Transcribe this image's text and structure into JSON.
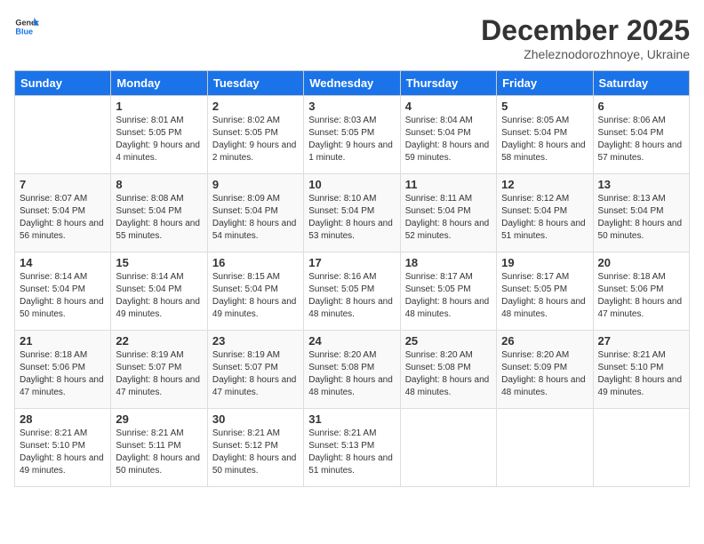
{
  "logo": {
    "line1": "General",
    "line2": "Blue"
  },
  "title": "December 2025",
  "subtitle": "Zheleznodorozhnoye, Ukraine",
  "weekdays": [
    "Sunday",
    "Monday",
    "Tuesday",
    "Wednesday",
    "Thursday",
    "Friday",
    "Saturday"
  ],
  "weeks": [
    [
      {
        "day": "",
        "sunrise": "",
        "sunset": "",
        "daylight": ""
      },
      {
        "day": "1",
        "sunrise": "Sunrise: 8:01 AM",
        "sunset": "Sunset: 5:05 PM",
        "daylight": "Daylight: 9 hours and 4 minutes."
      },
      {
        "day": "2",
        "sunrise": "Sunrise: 8:02 AM",
        "sunset": "Sunset: 5:05 PM",
        "daylight": "Daylight: 9 hours and 2 minutes."
      },
      {
        "day": "3",
        "sunrise": "Sunrise: 8:03 AM",
        "sunset": "Sunset: 5:05 PM",
        "daylight": "Daylight: 9 hours and 1 minute."
      },
      {
        "day": "4",
        "sunrise": "Sunrise: 8:04 AM",
        "sunset": "Sunset: 5:04 PM",
        "daylight": "Daylight: 8 hours and 59 minutes."
      },
      {
        "day": "5",
        "sunrise": "Sunrise: 8:05 AM",
        "sunset": "Sunset: 5:04 PM",
        "daylight": "Daylight: 8 hours and 58 minutes."
      },
      {
        "day": "6",
        "sunrise": "Sunrise: 8:06 AM",
        "sunset": "Sunset: 5:04 PM",
        "daylight": "Daylight: 8 hours and 57 minutes."
      }
    ],
    [
      {
        "day": "7",
        "sunrise": "Sunrise: 8:07 AM",
        "sunset": "Sunset: 5:04 PM",
        "daylight": "Daylight: 8 hours and 56 minutes."
      },
      {
        "day": "8",
        "sunrise": "Sunrise: 8:08 AM",
        "sunset": "Sunset: 5:04 PM",
        "daylight": "Daylight: 8 hours and 55 minutes."
      },
      {
        "day": "9",
        "sunrise": "Sunrise: 8:09 AM",
        "sunset": "Sunset: 5:04 PM",
        "daylight": "Daylight: 8 hours and 54 minutes."
      },
      {
        "day": "10",
        "sunrise": "Sunrise: 8:10 AM",
        "sunset": "Sunset: 5:04 PM",
        "daylight": "Daylight: 8 hours and 53 minutes."
      },
      {
        "day": "11",
        "sunrise": "Sunrise: 8:11 AM",
        "sunset": "Sunset: 5:04 PM",
        "daylight": "Daylight: 8 hours and 52 minutes."
      },
      {
        "day": "12",
        "sunrise": "Sunrise: 8:12 AM",
        "sunset": "Sunset: 5:04 PM",
        "daylight": "Daylight: 8 hours and 51 minutes."
      },
      {
        "day": "13",
        "sunrise": "Sunrise: 8:13 AM",
        "sunset": "Sunset: 5:04 PM",
        "daylight": "Daylight: 8 hours and 50 minutes."
      }
    ],
    [
      {
        "day": "14",
        "sunrise": "Sunrise: 8:14 AM",
        "sunset": "Sunset: 5:04 PM",
        "daylight": "Daylight: 8 hours and 50 minutes."
      },
      {
        "day": "15",
        "sunrise": "Sunrise: 8:14 AM",
        "sunset": "Sunset: 5:04 PM",
        "daylight": "Daylight: 8 hours and 49 minutes."
      },
      {
        "day": "16",
        "sunrise": "Sunrise: 8:15 AM",
        "sunset": "Sunset: 5:04 PM",
        "daylight": "Daylight: 8 hours and 49 minutes."
      },
      {
        "day": "17",
        "sunrise": "Sunrise: 8:16 AM",
        "sunset": "Sunset: 5:05 PM",
        "daylight": "Daylight: 8 hours and 48 minutes."
      },
      {
        "day": "18",
        "sunrise": "Sunrise: 8:17 AM",
        "sunset": "Sunset: 5:05 PM",
        "daylight": "Daylight: 8 hours and 48 minutes."
      },
      {
        "day": "19",
        "sunrise": "Sunrise: 8:17 AM",
        "sunset": "Sunset: 5:05 PM",
        "daylight": "Daylight: 8 hours and 48 minutes."
      },
      {
        "day": "20",
        "sunrise": "Sunrise: 8:18 AM",
        "sunset": "Sunset: 5:06 PM",
        "daylight": "Daylight: 8 hours and 47 minutes."
      }
    ],
    [
      {
        "day": "21",
        "sunrise": "Sunrise: 8:18 AM",
        "sunset": "Sunset: 5:06 PM",
        "daylight": "Daylight: 8 hours and 47 minutes."
      },
      {
        "day": "22",
        "sunrise": "Sunrise: 8:19 AM",
        "sunset": "Sunset: 5:07 PM",
        "daylight": "Daylight: 8 hours and 47 minutes."
      },
      {
        "day": "23",
        "sunrise": "Sunrise: 8:19 AM",
        "sunset": "Sunset: 5:07 PM",
        "daylight": "Daylight: 8 hours and 47 minutes."
      },
      {
        "day": "24",
        "sunrise": "Sunrise: 8:20 AM",
        "sunset": "Sunset: 5:08 PM",
        "daylight": "Daylight: 8 hours and 48 minutes."
      },
      {
        "day": "25",
        "sunrise": "Sunrise: 8:20 AM",
        "sunset": "Sunset: 5:08 PM",
        "daylight": "Daylight: 8 hours and 48 minutes."
      },
      {
        "day": "26",
        "sunrise": "Sunrise: 8:20 AM",
        "sunset": "Sunset: 5:09 PM",
        "daylight": "Daylight: 8 hours and 48 minutes."
      },
      {
        "day": "27",
        "sunrise": "Sunrise: 8:21 AM",
        "sunset": "Sunset: 5:10 PM",
        "daylight": "Daylight: 8 hours and 49 minutes."
      }
    ],
    [
      {
        "day": "28",
        "sunrise": "Sunrise: 8:21 AM",
        "sunset": "Sunset: 5:10 PM",
        "daylight": "Daylight: 8 hours and 49 minutes."
      },
      {
        "day": "29",
        "sunrise": "Sunrise: 8:21 AM",
        "sunset": "Sunset: 5:11 PM",
        "daylight": "Daylight: 8 hours and 50 minutes."
      },
      {
        "day": "30",
        "sunrise": "Sunrise: 8:21 AM",
        "sunset": "Sunset: 5:12 PM",
        "daylight": "Daylight: 8 hours and 50 minutes."
      },
      {
        "day": "31",
        "sunrise": "Sunrise: 8:21 AM",
        "sunset": "Sunset: 5:13 PM",
        "daylight": "Daylight: 8 hours and 51 minutes."
      },
      {
        "day": "",
        "sunrise": "",
        "sunset": "",
        "daylight": ""
      },
      {
        "day": "",
        "sunrise": "",
        "sunset": "",
        "daylight": ""
      },
      {
        "day": "",
        "sunrise": "",
        "sunset": "",
        "daylight": ""
      }
    ]
  ]
}
